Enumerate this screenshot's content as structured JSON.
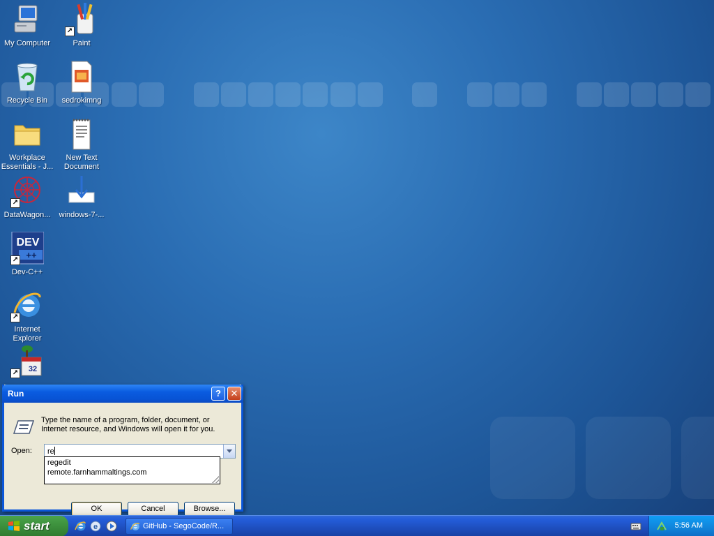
{
  "desktop_icons": [
    {
      "label": "My Computer",
      "icon": "my-computer-icon"
    },
    {
      "label": "Paint",
      "icon": "paint-icon",
      "shortcut": true
    },
    {
      "label": "Recycle Bin",
      "icon": "recycle-bin-icon"
    },
    {
      "label": "sedrokimng",
      "icon": "document-icon"
    },
    {
      "label": "Workplace Essentials - J...",
      "icon": "folder-icon"
    },
    {
      "label": "New Text Document",
      "icon": "text-document-icon"
    },
    {
      "label": "DataWagon...",
      "icon": "datawagon-icon",
      "shortcut": true
    },
    {
      "label": "windows-7-...",
      "icon": "download-icon"
    },
    {
      "label": "Dev-C++",
      "icon": "dev-cpp-icon",
      "shortcut": true
    },
    {
      "label": "Internet Explorer",
      "icon": "internet-explorer-icon",
      "shortcut": true
    },
    {
      "label": "",
      "icon": "calendar-app-icon",
      "shortcut": true
    }
  ],
  "run_dialog": {
    "title": "Run",
    "help": "?",
    "close": "✕",
    "description": "Type the name of a program, folder, document, or Internet resource, and Windows will open it for you.",
    "open_label": "Open:",
    "open_value": "re",
    "suggestions": [
      "regedit",
      "remote.farnhammaltings.com"
    ],
    "ok_label": "OK",
    "cancel_label": "Cancel",
    "browse_label": "Browse..."
  },
  "taskbar": {
    "start_label": "start",
    "quick_launch": [
      "internet-explorer-icon",
      "browser-icon",
      "media-player-icon"
    ],
    "task_label": "GitHub - SegoCode/R...",
    "clock": "5:56 AM"
  },
  "colors": {
    "desktop": "#2a6db3",
    "titlebar": "#0a5ce0",
    "start": "#3c8f3c",
    "tray": "#1083d9"
  }
}
